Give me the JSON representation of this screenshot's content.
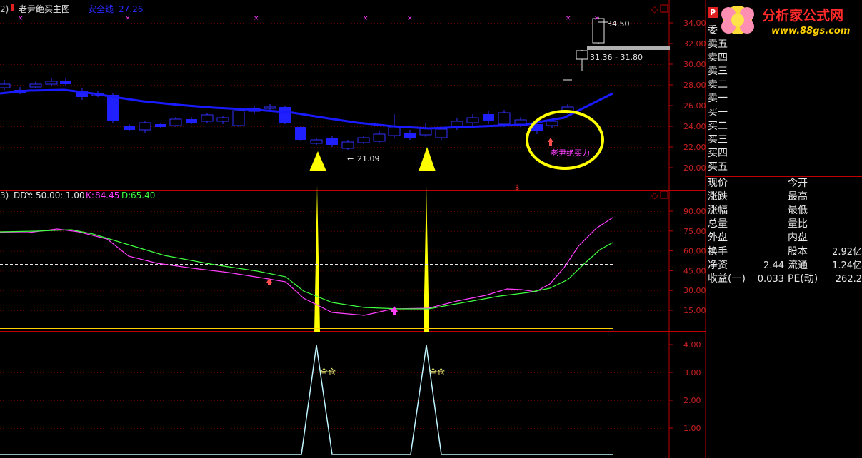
{
  "main_chart": {
    "panel_num": "2)",
    "title": "老尹绝买主图",
    "safety_line_label": "安全线",
    "safety_line_value": "27.26",
    "y_ticks": [
      "34.00",
      "32.00",
      "30.00",
      "28.00",
      "26.00",
      "24.00",
      "22.00",
      "20.00"
    ],
    "annotations": {
      "low_marker": "21.09",
      "high_marker": "34.50",
      "range_marker": "31.36 - 31.80",
      "buy_text": "老尹绝买力",
      "buy_marker": "$"
    }
  },
  "indicator_chart": {
    "panel_num": "3)",
    "ddy_label": "DDY:",
    "ddy_value": "50.00",
    "ratio_text": ": 1.00",
    "k_label": "K:",
    "k_value": "84.45",
    "d_label": "D:",
    "d_value": "65.40",
    "y_ticks": [
      "90.00",
      "75.00",
      "60.00",
      "45.00",
      "30.00",
      "15.00"
    ],
    "colors": {
      "k": "#ff40ff",
      "d": "#40ff40"
    }
  },
  "signal_chart": {
    "y_ticks": [
      "4.00",
      "3.00",
      "2.00",
      "1.00"
    ],
    "signal_label": "全仓",
    "signal_value": 4
  },
  "quote_panel": {
    "logo_title": "分析家公式网",
    "logo_url": "www.88gs.com",
    "p_badge": "P",
    "commission": "委",
    "sell_levels": [
      "卖五",
      "卖四",
      "卖三",
      "卖二",
      "卖一"
    ],
    "buy_levels": [
      "买一",
      "买二",
      "买三",
      "买四",
      "买五"
    ],
    "stats_left": [
      "现价",
      "涨跌",
      "涨幅",
      "总量",
      "外盘"
    ],
    "stats_right": [
      "今开",
      "最高",
      "最低",
      "量比",
      "内盘"
    ],
    "fund_rows": [
      {
        "l": "换手",
        "lv": "",
        "r": "股本",
        "rv": "2.92亿"
      },
      {
        "l": "净资",
        "lv": "2.44",
        "r": "流通",
        "rv": "1.24亿"
      },
      {
        "l": "收益(一)",
        "lv": "0.033",
        "r": "PE(动)",
        "rv": "262.2"
      }
    ]
  },
  "colors": {
    "background": "#000000",
    "axis": "#c00000",
    "ma_line": "#1818ff",
    "up_candle": "#3030ff",
    "arrow": "#ffff00",
    "signal_line": "#aaf0ff",
    "circle": "#ffff00"
  }
}
